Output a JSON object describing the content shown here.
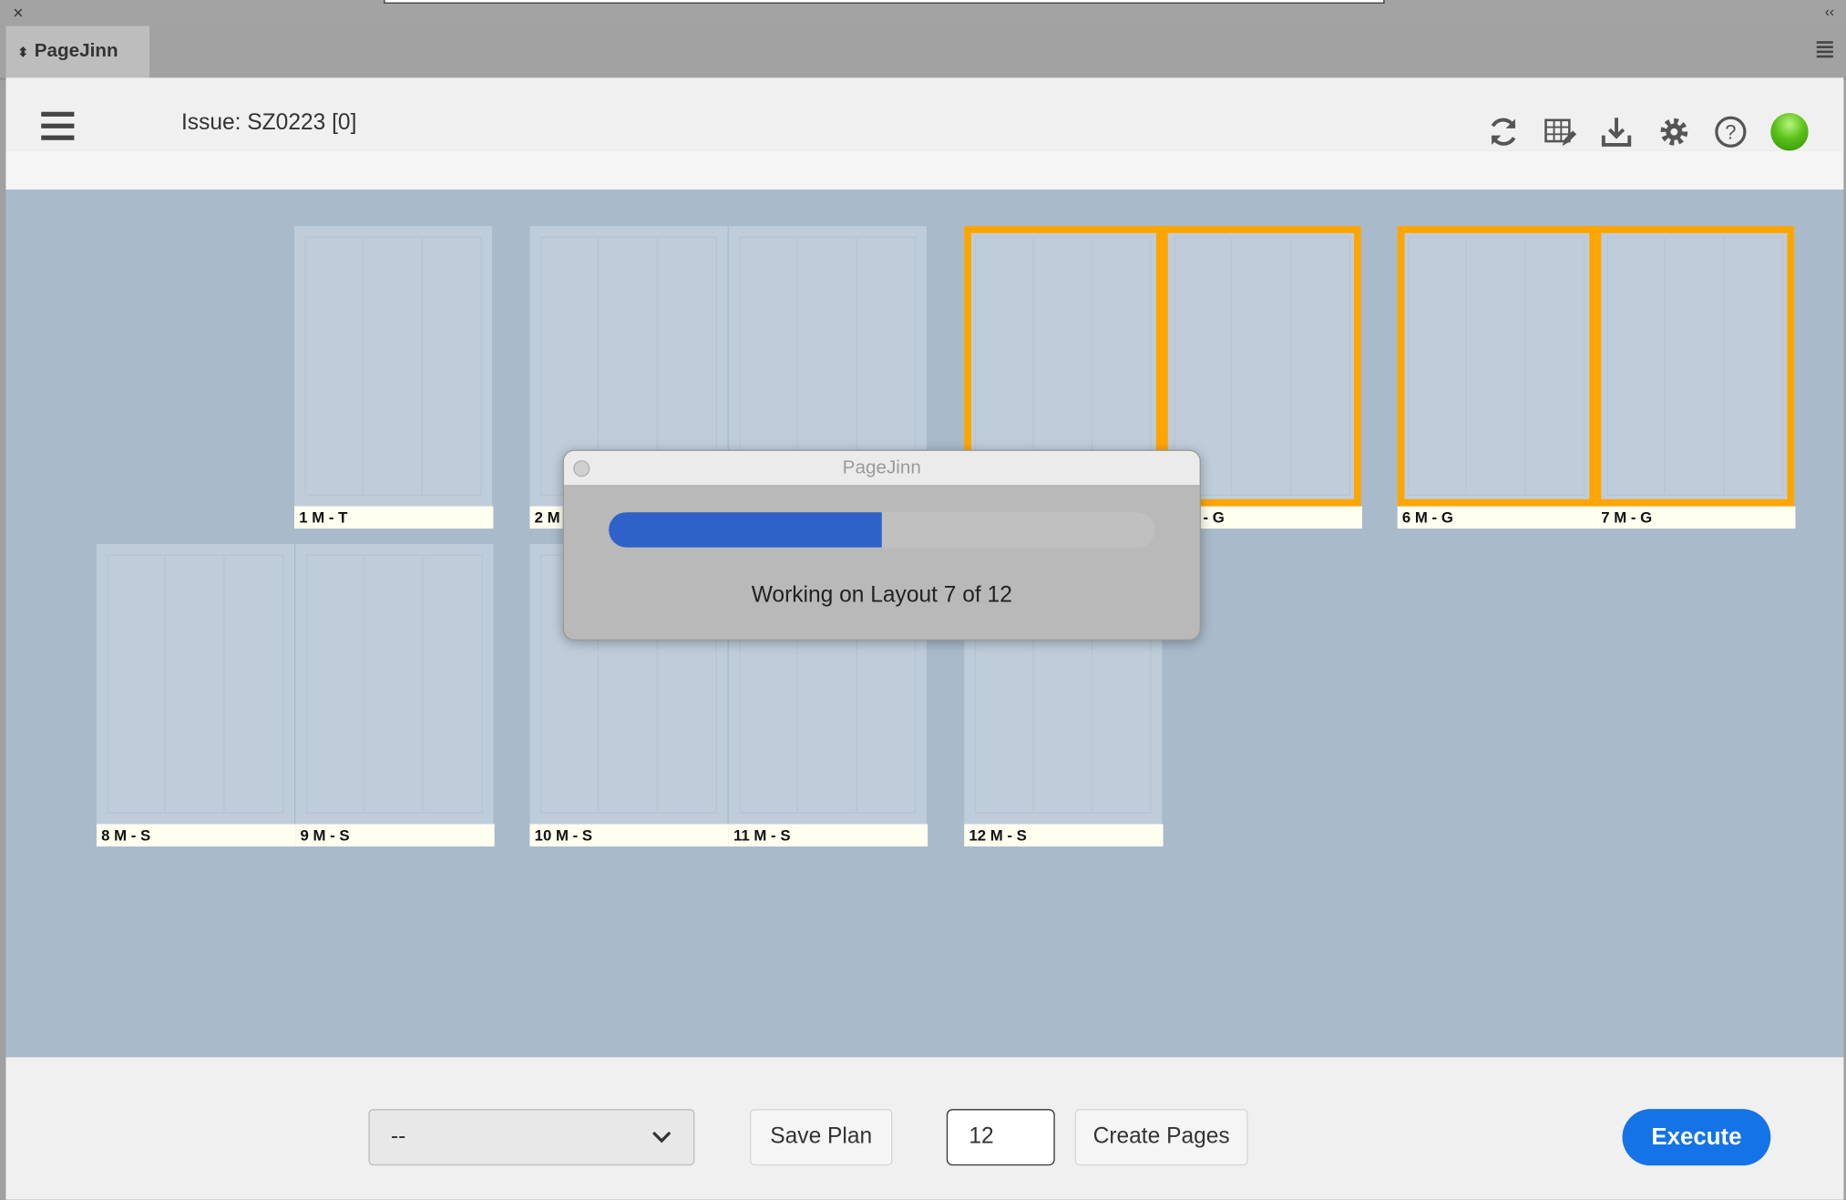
{
  "window": {
    "close_icon": "×",
    "collapse_icon": "‹‹"
  },
  "tab": {
    "label": "PageJinn"
  },
  "header": {
    "issue": "Issue: SZ0223 [0]",
    "status_color": "#5cc21a",
    "icons": [
      "menu-icon",
      "refresh-icon",
      "grid-edit-icon",
      "download-icon",
      "gear-icon",
      "help-icon",
      "status-indicator"
    ]
  },
  "pages": [
    {
      "label": "1 M - T"
    },
    {
      "label": "2 M"
    },
    {
      "label": ""
    },
    {
      "label": ""
    },
    {
      "label": "- G"
    },
    {
      "label": "6 M - G"
    },
    {
      "label": "7 M - G"
    },
    {
      "label": "8 M - S"
    },
    {
      "label": "9 M - S"
    },
    {
      "label": "10 M - S"
    },
    {
      "label": "11 M - S"
    },
    {
      "label": "12 M - S"
    }
  ],
  "selection_color": "#ffa500",
  "dialog": {
    "title": "PageJinn",
    "message": "Working on Layout 7 of 12",
    "progress": 0.5,
    "progress_color": "#2f62c9"
  },
  "footer": {
    "select_value": "--",
    "save_plan": "Save Plan",
    "page_count": "12",
    "create_pages": "Create Pages",
    "execute": "Execute",
    "execute_color": "#1473e6"
  }
}
